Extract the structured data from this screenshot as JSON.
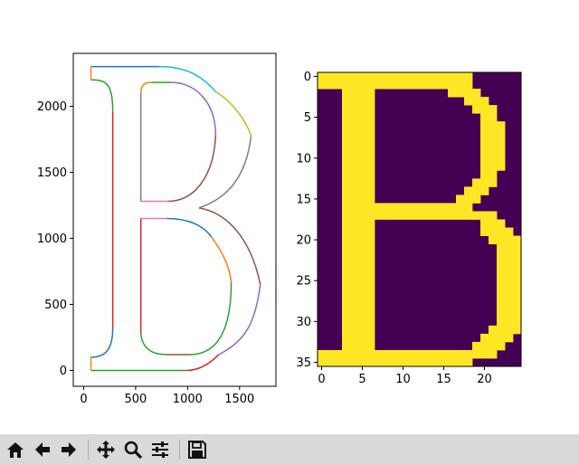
{
  "colors": {
    "tab10": [
      "#1f77b4",
      "#ff7f0e",
      "#2ca02c",
      "#d62728",
      "#9467bd",
      "#8c564b",
      "#e377c2",
      "#7f7f7f",
      "#bcbd22",
      "#17becf"
    ],
    "viridis_low": "#440154",
    "viridis_high": "#fde725",
    "toolbar_bg": "#d9d9d9"
  },
  "toolbar": {
    "buttons": [
      {
        "name": "home-button",
        "icon": "home-icon"
      },
      {
        "name": "back-button",
        "icon": "arrow-left-icon"
      },
      {
        "name": "forward-button",
        "icon": "arrow-right-icon"
      },
      {
        "name": "pan-button",
        "icon": "move-icon"
      },
      {
        "name": "zoom-button",
        "icon": "magnifier-icon"
      },
      {
        "name": "configure-subplots-button",
        "icon": "sliders-icon"
      },
      {
        "name": "save-button",
        "icon": "floppy-icon"
      }
    ]
  },
  "chart_data": [
    {
      "type": "line",
      "title": "",
      "xlim": [
        -100,
        1850
      ],
      "ylim": [
        -120,
        2400
      ],
      "xticks": [
        "0",
        "500",
        "1000",
        "1500"
      ],
      "yticks": [
        "0",
        "500",
        "1000",
        "1500",
        "2000"
      ],
      "grid": false,
      "segments": [
        {
          "c": 0,
          "p": [
            [
              70,
              2300
            ],
            [
              730,
              2300
            ]
          ]
        },
        {
          "c": 9,
          "p": [
            [
              730,
              2300
            ],
            [
              1000,
              2300
            ],
            [
              1150,
              2220
            ],
            [
              1270,
              2110
            ]
          ]
        },
        {
          "c": 8,
          "p": [
            [
              1270,
              2110
            ],
            [
              1500,
              2000
            ],
            [
              1610,
              1800
            ],
            [
              1610,
              1770
            ]
          ]
        },
        {
          "c": 7,
          "p": [
            [
              1610,
              1770
            ],
            [
              1560,
              1450
            ],
            [
              1370,
              1300
            ],
            [
              1110,
              1230
            ]
          ]
        },
        {
          "c": 5,
          "p": [
            [
              1110,
              1230
            ],
            [
              1350,
              1200
            ],
            [
              1600,
              1030
            ],
            [
              1700,
              650
            ]
          ]
        },
        {
          "c": 4,
          "p": [
            [
              1700,
              650
            ],
            [
              1650,
              350
            ],
            [
              1550,
              220
            ],
            [
              1300,
              120
            ]
          ]
        },
        {
          "c": 3,
          "p": [
            [
              1300,
              120
            ],
            [
              1200,
              40
            ],
            [
              1100,
              0
            ],
            [
              990,
              0
            ]
          ]
        },
        {
          "c": 2,
          "p": [
            [
              70,
              0
            ],
            [
              990,
              0
            ]
          ]
        },
        {
          "c": 1,
          "p": [
            [
              70,
              0
            ],
            [
              70,
              100
            ]
          ]
        },
        {
          "c": 0,
          "p": [
            [
              70,
              100
            ],
            [
              200,
              100
            ],
            [
              280,
              150
            ],
            [
              280,
              320
            ]
          ]
        },
        {
          "c": 3,
          "p": [
            [
              280,
              320
            ],
            [
              280,
              1960
            ]
          ]
        },
        {
          "c": 2,
          "p": [
            [
              280,
              1960
            ],
            [
              280,
              2170
            ],
            [
              220,
              2200
            ],
            [
              70,
              2200
            ]
          ]
        },
        {
          "c": 1,
          "p": [
            [
              70,
              2200
            ],
            [
              70,
              2300
            ]
          ]
        },
        {
          "c": 1,
          "p": [
            [
              550,
              2100
            ],
            [
              550,
              2170
            ],
            [
              600,
              2180
            ],
            [
              650,
              2180
            ]
          ]
        },
        {
          "c": 2,
          "p": [
            [
              650,
              2180
            ],
            [
              850,
              2180
            ]
          ]
        },
        {
          "c": 4,
          "p": [
            [
              850,
              2180
            ],
            [
              1050,
              2180
            ],
            [
              1270,
              2050
            ],
            [
              1270,
              1780
            ]
          ]
        },
        {
          "c": 5,
          "p": [
            [
              1270,
              1780
            ],
            [
              1250,
              1450
            ],
            [
              1050,
              1280
            ],
            [
              810,
              1280
            ]
          ]
        },
        {
          "c": 6,
          "p": [
            [
              810,
              1280
            ],
            [
              550,
              1280
            ]
          ]
        },
        {
          "c": 7,
          "p": [
            [
              550,
              1280
            ],
            [
              550,
              2100
            ]
          ]
        },
        {
          "c": 6,
          "p": [
            [
              550,
              1150
            ],
            [
              800,
              1150
            ]
          ]
        },
        {
          "c": 0,
          "p": [
            [
              800,
              1150
            ],
            [
              1000,
              1150
            ],
            [
              1150,
              1100
            ],
            [
              1230,
              1010
            ]
          ]
        },
        {
          "c": 1,
          "p": [
            [
              1230,
              1010
            ],
            [
              1330,
              900
            ],
            [
              1400,
              800
            ],
            [
              1420,
              670
            ]
          ]
        },
        {
          "c": 2,
          "p": [
            [
              1420,
              670
            ],
            [
              1420,
              200
            ],
            [
              1200,
              120
            ],
            [
              1020,
              120
            ]
          ]
        },
        {
          "c": 5,
          "p": [
            [
              1020,
              120
            ],
            [
              790,
              120
            ]
          ]
        },
        {
          "c": 2,
          "p": [
            [
              790,
              120
            ],
            [
              640,
              120
            ],
            [
              560,
              180
            ],
            [
              550,
              280
            ]
          ]
        },
        {
          "c": 3,
          "p": [
            [
              550,
              280
            ],
            [
              550,
              1150
            ]
          ]
        }
      ]
    },
    {
      "type": "heatmap",
      "title": "",
      "xticks": [
        "0",
        "5",
        "10",
        "15",
        "20"
      ],
      "yticks": [
        "0",
        "5",
        "10",
        "15",
        "20",
        "25",
        "30",
        "35"
      ],
      "rows": [
        "1111111111111111111000000",
        "1111111111111111111000000",
        "0001111000000000111100000",
        "0001111000000000001110000",
        "0001111000000000000111000",
        "0001111000000000000011000",
        "0001111000000000000011100",
        "0001111000000000000011100",
        "0001111000000000000011100",
        "0001111000000000000011100",
        "0001111000000000000011100",
        "0001111000000000000011100",
        "0001111000000000000011000",
        "0001111000000000000111000",
        "0001111000000000001110000",
        "0001111000000000011100000",
        "0001111111111111111000000",
        "0001111111111111111111000",
        "0001111000000000000011100",
        "0001111000000000000011110",
        "0001111000000000000001111",
        "0001111000000000000000111",
        "0001111000000000000000111",
        "0001111000000000000000111",
        "0001111000000000000000111",
        "0001111000000000000000111",
        "0001111000000000000000111",
        "0001111000000000000000111",
        "0001111000000000000000111",
        "0001111000000000000000111",
        "0001111000000000000000111",
        "0001111000000000000001111",
        "0001111000000000000011110",
        "0001111000000000000111100",
        "1111111111111111111111000",
        "1111111111111111111000000"
      ]
    }
  ]
}
